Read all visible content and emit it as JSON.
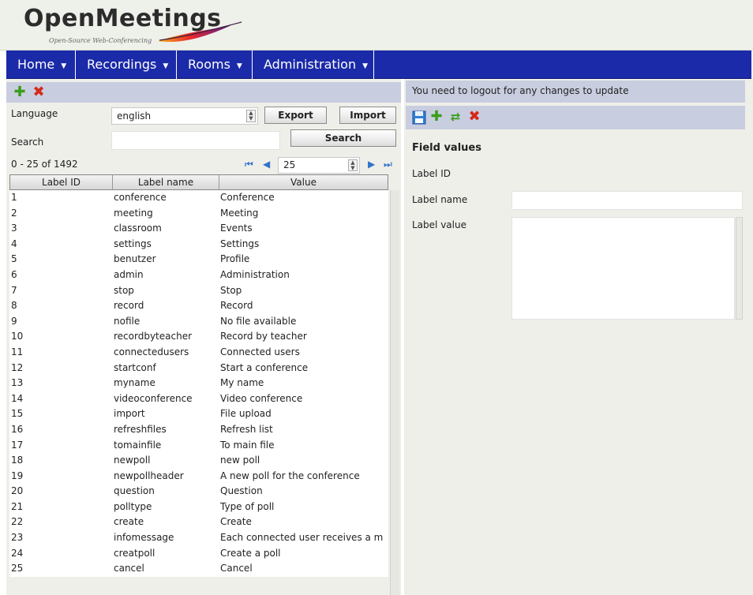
{
  "header": {
    "logo_title": "OpenMeetings",
    "logo_subtitle": "Open-Source Web-Conferencing"
  },
  "menu": [
    {
      "label": "Home"
    },
    {
      "label": "Recordings"
    },
    {
      "label": "Rooms"
    },
    {
      "label": "Administration"
    }
  ],
  "left": {
    "language_label": "Language",
    "language_value": "english",
    "export_label": "Export",
    "import_label": "Import",
    "search_label": "Search",
    "search_value": "",
    "search_button": "Search",
    "range_text": "0 - 25 of 1492",
    "page_size": "25",
    "columns": [
      "Label ID",
      "Label name",
      "Value"
    ],
    "rows": [
      [
        "1",
        "conference",
        "Conference"
      ],
      [
        "2",
        "meeting",
        "Meeting"
      ],
      [
        "3",
        "classroom",
        "Events"
      ],
      [
        "4",
        "settings",
        "Settings"
      ],
      [
        "5",
        "benutzer",
        "Profile"
      ],
      [
        "6",
        "admin",
        "Administration"
      ],
      [
        "7",
        "stop",
        "Stop"
      ],
      [
        "8",
        "record",
        "Record"
      ],
      [
        "9",
        "nofile",
        "No file available"
      ],
      [
        "10",
        "recordbyteacher",
        "Record by teacher"
      ],
      [
        "11",
        "connectedusers",
        "Connected users"
      ],
      [
        "12",
        "startconf",
        "Start a conference"
      ],
      [
        "13",
        "myname",
        "My name"
      ],
      [
        "14",
        "videoconference",
        "Video conference"
      ],
      [
        "15",
        "import",
        "File upload"
      ],
      [
        "16",
        "refreshfiles",
        "Refresh list"
      ],
      [
        "17",
        "tomainfile",
        "To main file"
      ],
      [
        "18",
        "newpoll",
        "new poll"
      ],
      [
        "19",
        "newpollheader",
        "A new poll for the conference"
      ],
      [
        "20",
        "question",
        "Question"
      ],
      [
        "21",
        "polltype",
        "Type of poll"
      ],
      [
        "22",
        "create",
        "Create"
      ],
      [
        "23",
        "infomessage",
        "Each connected user receives a m"
      ],
      [
        "24",
        "creatpoll",
        "Create a poll"
      ],
      [
        "25",
        "cancel",
        "Cancel"
      ]
    ]
  },
  "right": {
    "notice": "You need to logout for any changes to update",
    "section_title": "Field values",
    "label_id": "Label ID",
    "label_name": "Label name",
    "label_value": "Label value"
  },
  "icons": {
    "add": "plus-icon",
    "delete": "cross-icon",
    "save": "save-icon",
    "refresh": "refresh-icon",
    "first_page": "first-page-icon",
    "prev_page": "prev-page-icon",
    "next_page": "next-page-icon",
    "last_page": "last-page-icon"
  },
  "colors": {
    "menubar": "#1b2aa8",
    "toolbar": "#c9cde0",
    "panel": "#eeefe9"
  }
}
